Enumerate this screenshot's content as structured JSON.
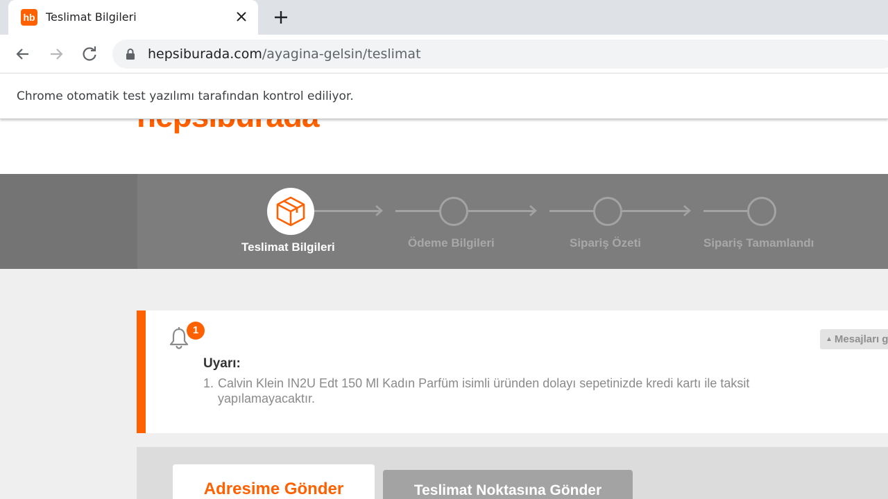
{
  "browser": {
    "tab_title": "Teslimat Bilgileri",
    "favicon_text": "hb",
    "url_domain": "hepsiburada.com",
    "url_path": "/ayagina-gelsin/teslimat",
    "infobar_text": "Chrome otomatik test yazılımı tarafından kontrol ediliyor."
  },
  "header": {
    "logo_text": "hepsiburada",
    "brand_color": "#ff6000"
  },
  "steps": [
    {
      "label": "Teslimat Bilgileri",
      "active": true,
      "icon": "package-icon"
    },
    {
      "label": "Ödeme Bilgileri",
      "active": false
    },
    {
      "label": "Sipariş Özeti",
      "active": false
    },
    {
      "label": "Sipariş Tamamlandı",
      "active": false
    }
  ],
  "alert": {
    "badge_count": "1",
    "title": "Uyarı:",
    "item_number": "1.",
    "item_text": "Calvin Klein IN2U Edt 150 Ml Kadın Parfüm isimli üründen dolayı sepetinizde kredi kartı ile taksit yapılamayacaktır.",
    "messages_button": "Mesajları gizle"
  },
  "delivery": {
    "address_tab": "Adresime Gönder",
    "pickup_tab": "Teslimat Noktasına Gönder"
  }
}
